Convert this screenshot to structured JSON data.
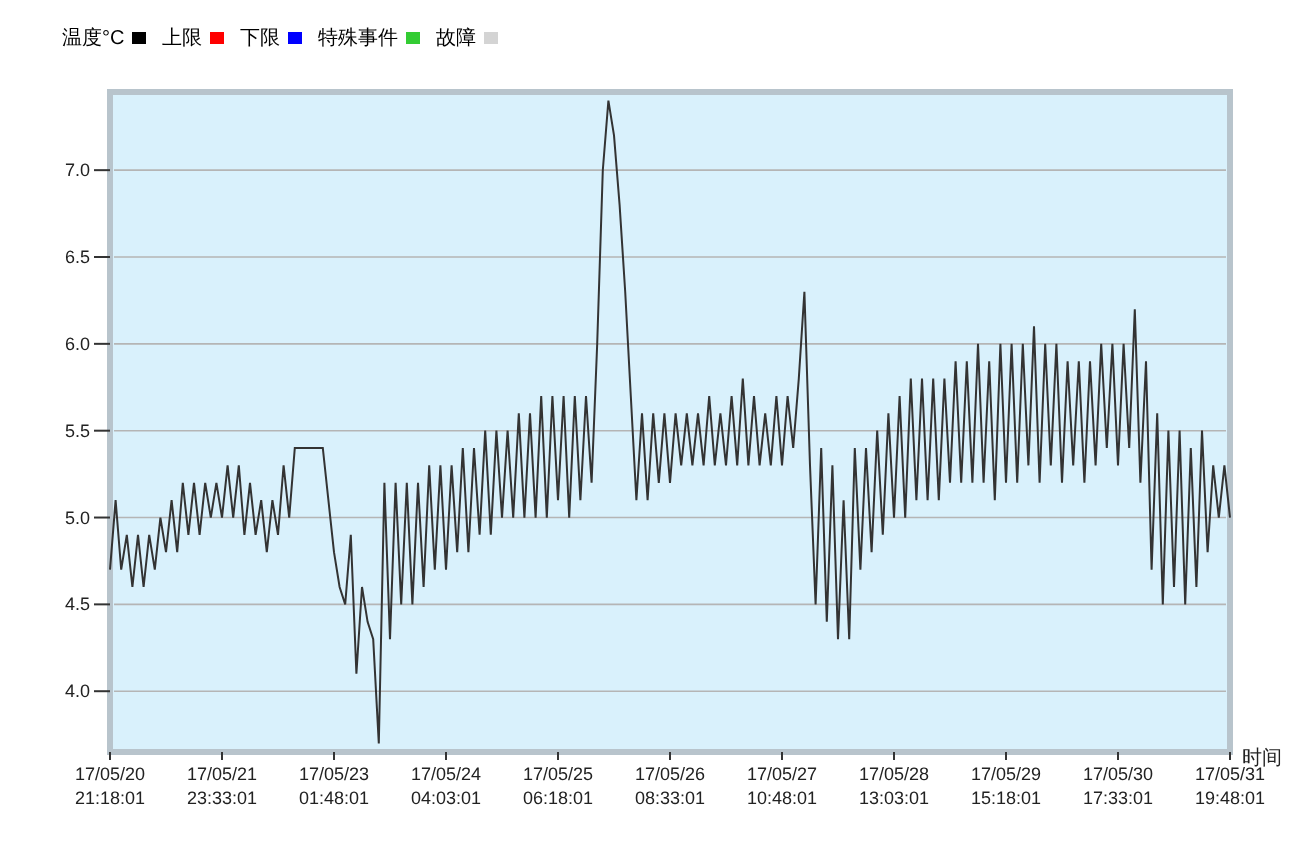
{
  "legend": [
    {
      "label": "温度°C",
      "color": "#000000"
    },
    {
      "label": "上限",
      "color": "#ff0000"
    },
    {
      "label": "下限",
      "color": "#0000ff"
    },
    {
      "label": "特殊事件",
      "color": "#33cc33"
    },
    {
      "label": "故障",
      "color": "#d4d4d4"
    }
  ],
  "chart_data": {
    "type": "line",
    "grid": true,
    "xlabel": "时间",
    "ylim": [
      3.65,
      7.45
    ],
    "yticks": [
      {
        "value": 4,
        "label": "4.0"
      },
      {
        "value": 4.5,
        "label": "4.5"
      },
      {
        "value": 5,
        "label": "5.0"
      },
      {
        "value": 5.5,
        "label": "5.5"
      },
      {
        "value": 6,
        "label": "6.0"
      },
      {
        "value": 6.5,
        "label": "6.5"
      },
      {
        "value": 7,
        "label": "7.0"
      }
    ],
    "categories": [
      "17/05/20 21:18:01",
      null,
      null,
      null,
      null,
      null,
      null,
      null,
      null,
      null,
      null,
      null,
      null,
      null,
      null,
      null,
      null,
      null,
      null,
      null,
      "17/05/21 23:33:01",
      null,
      null,
      null,
      null,
      null,
      null,
      null,
      null,
      null,
      null,
      null,
      null,
      null,
      null,
      null,
      null,
      null,
      null,
      null,
      "17/05/23 01:48:01",
      null,
      null,
      null,
      null,
      null,
      null,
      null,
      null,
      null,
      null,
      null,
      null,
      null,
      null,
      null,
      null,
      null,
      null,
      null,
      "17/05/24 04:03:01",
      null,
      null,
      null,
      null,
      null,
      null,
      null,
      null,
      null,
      null,
      null,
      null,
      null,
      null,
      null,
      null,
      null,
      null,
      null,
      "17/05/25 06:18:01",
      null,
      null,
      null,
      null,
      null,
      null,
      null,
      null,
      null,
      null,
      null,
      null,
      null,
      null,
      null,
      null,
      null,
      null,
      null,
      "17/05/26 08:33:01",
      null,
      null,
      null,
      null,
      null,
      null,
      null,
      null,
      null,
      null,
      null,
      null,
      null,
      null,
      null,
      null,
      null,
      null,
      null,
      "17/05/27 10:48:01",
      null,
      null,
      null,
      null,
      null,
      null,
      null,
      null,
      null,
      null,
      null,
      null,
      null,
      null,
      null,
      null,
      null,
      null,
      null,
      "17/05/28 13:03:01",
      null,
      null,
      null,
      null,
      null,
      null,
      null,
      null,
      null,
      null,
      null,
      null,
      null,
      null,
      null,
      null,
      null,
      null,
      null,
      "17/05/29 15:18:01",
      null,
      null,
      null,
      null,
      null,
      null,
      null,
      null,
      null,
      null,
      null,
      null,
      null,
      null,
      null,
      null,
      null,
      null,
      null,
      "17/05/30 17:33:01",
      null,
      null,
      null,
      null,
      null,
      null,
      null,
      null,
      null,
      null,
      null,
      null,
      null,
      null,
      null,
      null,
      null,
      null,
      null,
      "17/05/31 19:48:01"
    ],
    "series": [
      {
        "color": "#333333",
        "values": [
          4.7,
          5.1,
          4.7,
          4.9,
          4.6,
          4.9,
          4.6,
          4.9,
          4.7,
          5.0,
          4.8,
          5.1,
          4.8,
          5.2,
          4.9,
          5.2,
          4.9,
          5.2,
          5.0,
          5.2,
          5.0,
          5.3,
          5.0,
          5.3,
          4.9,
          5.2,
          4.9,
          5.1,
          4.8,
          5.1,
          4.9,
          5.3,
          5.0,
          5.4,
          5.4,
          5.4,
          5.4,
          5.4,
          5.4,
          5.1,
          4.8,
          4.6,
          4.5,
          4.9,
          4.1,
          4.6,
          4.4,
          4.3,
          3.7,
          5.2,
          4.3,
          5.2,
          4.5,
          5.2,
          4.5,
          5.2,
          4.6,
          5.3,
          4.7,
          5.3,
          4.7,
          5.3,
          4.8,
          5.4,
          4.8,
          5.4,
          4.9,
          5.5,
          4.9,
          5.5,
          5.0,
          5.5,
          5.0,
          5.6,
          5.0,
          5.6,
          5.0,
          5.7,
          5.0,
          5.7,
          5.1,
          5.7,
          5.0,
          5.7,
          5.1,
          5.7,
          5.2,
          6.0,
          7.0,
          7.4,
          7.2,
          6.8,
          6.3,
          5.7,
          5.1,
          5.6,
          5.1,
          5.6,
          5.2,
          5.6,
          5.2,
          5.6,
          5.3,
          5.6,
          5.3,
          5.6,
          5.3,
          5.7,
          5.3,
          5.6,
          5.3,
          5.7,
          5.3,
          5.8,
          5.3,
          5.7,
          5.3,
          5.6,
          5.3,
          5.7,
          5.3,
          5.7,
          5.4,
          5.8,
          6.3,
          5.3,
          4.5,
          5.4,
          4.4,
          5.3,
          4.3,
          5.1,
          4.3,
          5.4,
          4.7,
          5.4,
          4.8,
          5.5,
          4.9,
          5.6,
          5.0,
          5.7,
          5.0,
          5.8,
          5.1,
          5.8,
          5.1,
          5.8,
          5.1,
          5.8,
          5.2,
          5.9,
          5.2,
          5.9,
          5.2,
          6.0,
          5.2,
          5.9,
          5.1,
          6.0,
          5.2,
          6.0,
          5.2,
          6.0,
          5.3,
          6.1,
          5.2,
          6.0,
          5.3,
          6.0,
          5.2,
          5.9,
          5.3,
          5.9,
          5.2,
          5.9,
          5.3,
          6.0,
          5.4,
          6.0,
          5.3,
          6.0,
          5.4,
          6.2,
          5.2,
          5.9,
          4.7,
          5.6,
          4.5,
          5.5,
          4.6,
          5.5,
          4.5,
          5.4,
          4.6,
          5.5,
          4.8,
          5.3,
          5.0,
          5.3,
          5.0
        ]
      }
    ]
  }
}
